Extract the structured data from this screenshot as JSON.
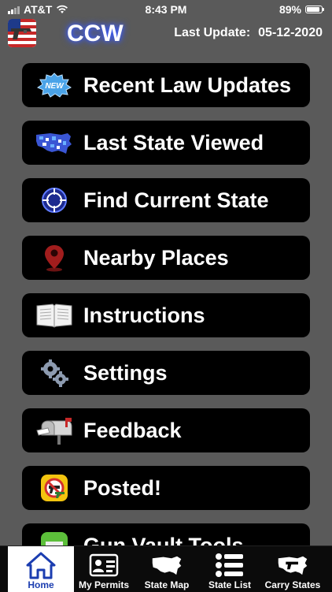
{
  "status_bar": {
    "carrier": "AT&T",
    "time": "8:43 PM",
    "battery": "89%",
    "battery_level": 0.89
  },
  "header": {
    "title": "CCW",
    "last_update_label": "Last Update:",
    "last_update_date": "05-12-2020"
  },
  "menu": {
    "items": [
      {
        "label": "Recent Law Updates",
        "icon": "new-badge-icon"
      },
      {
        "label": "Last State Viewed",
        "icon": "us-map-icon"
      },
      {
        "label": "Find Current State",
        "icon": "crosshair-icon"
      },
      {
        "label": "Nearby Places",
        "icon": "map-pin-icon"
      },
      {
        "label": "Instructions",
        "icon": "book-icon"
      },
      {
        "label": "Settings",
        "icon": "gears-icon"
      },
      {
        "label": "Feedback",
        "icon": "mailbox-icon"
      },
      {
        "label": "Posted!",
        "icon": "no-guns-sign-icon"
      },
      {
        "label": "Gun Vault Tools",
        "icon": "gun-vault-icon"
      }
    ]
  },
  "tabs": [
    {
      "label": "Home",
      "icon": "home-icon",
      "active": true
    },
    {
      "label": "My Permits",
      "icon": "id-card-icon"
    },
    {
      "label": "State Map",
      "icon": "us-map-icon"
    },
    {
      "label": "State List",
      "icon": "list-icon"
    },
    {
      "label": "Carry States",
      "icon": "carry-states-icon"
    }
  ],
  "colors": {
    "background": "#5a5a5a",
    "button": "#000000",
    "active_tab": "#ffffff",
    "active_tab_accent": "#1b3db0",
    "title_glow": "#3a5bff"
  }
}
